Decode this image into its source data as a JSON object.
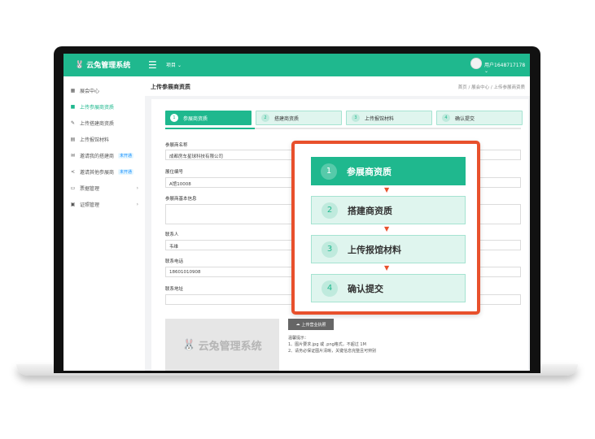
{
  "app": {
    "logo_text": "云兔管理系统",
    "nav_item": "项目",
    "username": "用户1648717178"
  },
  "sidebar": {
    "items": [
      {
        "label": "展会中心",
        "icon": "grid-icon"
      },
      {
        "label": "上传参展商资质",
        "icon": "folder-icon"
      },
      {
        "label": "上传搭建商资质",
        "icon": "edit-icon"
      },
      {
        "label": "上传报馆材料",
        "icon": "document-icon"
      },
      {
        "label": "邀请我的搭建商",
        "icon": "mail-icon",
        "badge": "未开通"
      },
      {
        "label": "邀请其他参展商",
        "icon": "share-icon",
        "badge": "未开通"
      },
      {
        "label": "票据管理",
        "icon": "receipt-icon"
      },
      {
        "label": "证照管理",
        "icon": "id-icon"
      }
    ]
  },
  "page": {
    "title": "上传参展商资质",
    "breadcrumb": "首页 / 展会中心 / 上传参展商资质"
  },
  "steps": [
    {
      "num": "1",
      "label": "参展商资质"
    },
    {
      "num": "2",
      "label": "搭建商资质"
    },
    {
      "num": "3",
      "label": "上传报馆材料"
    },
    {
      "num": "4",
      "label": "确认提交"
    }
  ],
  "form": {
    "exhibitor_name_label": "参展商名称",
    "exhibitor_name_value": "成都房车星球科技有限公司",
    "booth_no_label": "展位编号",
    "booth_no_value": "A馆10008",
    "basic_info_label": "参展商基本信息",
    "contact_label": "联系人",
    "contact_value": "韦维",
    "phone_label": "联系电话",
    "phone_value": "18601010908",
    "address_label": "联系地址",
    "upload_button": "上传营业执照",
    "tips": [
      "温馨提示：",
      "1、图片要求.jpg 或 .png格式，不超过 1M",
      "2、请务必保证图片清晰，关键信息完整且可辨别"
    ]
  },
  "accent_color": "#1fb88e",
  "highlight_color": "#e8502c"
}
